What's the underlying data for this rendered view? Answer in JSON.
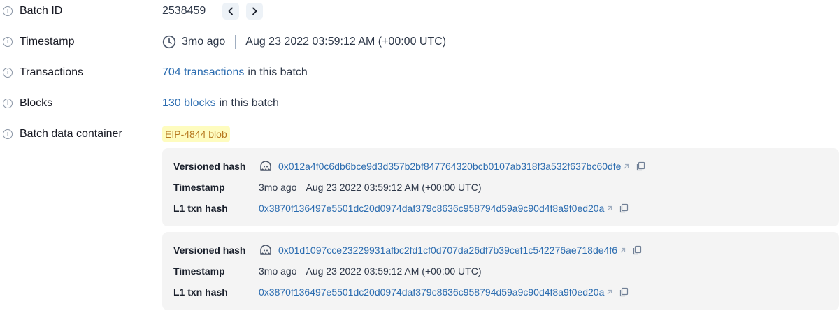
{
  "batch_id": {
    "label": "Batch ID",
    "value": "2538459"
  },
  "timestamp": {
    "label": "Timestamp",
    "relative": "3mo ago",
    "absolute": "Aug 23 2022 03:59:12 AM (+00:00 UTC)"
  },
  "transactions": {
    "label": "Transactions",
    "link_text": "704 transactions",
    "suffix": "in this batch"
  },
  "blocks": {
    "label": "Blocks",
    "link_text": "130 blocks",
    "suffix": "in this batch"
  },
  "container": {
    "label": "Batch data container",
    "tag": "EIP-4844 blob"
  },
  "blobs": [
    {
      "versioned_hash_label": "Versioned hash",
      "versioned_hash": "0x012a4f0c6db6bce9d3d357b2bf847764320bcb0107ab318f3a532f637bc60dfe",
      "timestamp_label": "Timestamp",
      "timestamp_relative": "3mo ago",
      "timestamp_absolute": "Aug 23 2022 03:59:12 AM (+00:00 UTC)",
      "l1_label": "L1 txn hash",
      "l1_hash": "0x3870f136497e5501dc20d0974daf379c8636c958794d59a9c90d4f8a9f0ed20a"
    },
    {
      "versioned_hash_label": "Versioned hash",
      "versioned_hash": "0x01d1097cce23229931afbc2fd1cf0d707da26df7b39cef1c542276ae718de4f6",
      "timestamp_label": "Timestamp",
      "timestamp_relative": "3mo ago",
      "timestamp_absolute": "Aug 23 2022 03:59:12 AM (+00:00 UTC)",
      "l1_label": "L1 txn hash",
      "l1_hash": "0x3870f136497e5501dc20d0974daf379c8636c958794d59a9c90d4f8a9f0ed20a"
    }
  ],
  "icons": {
    "info": "info-icon",
    "prev": "chevron-left-icon",
    "next": "chevron-right-icon",
    "clock": "clock-icon",
    "blob": "blob-icon",
    "external": "external-link-icon",
    "copy": "copy-icon"
  },
  "colors": {
    "link": "#2b6cb0",
    "tag_bg": "#fefcbf",
    "tag_text": "#b7791f",
    "blob_bg": "#f4f4f4"
  }
}
